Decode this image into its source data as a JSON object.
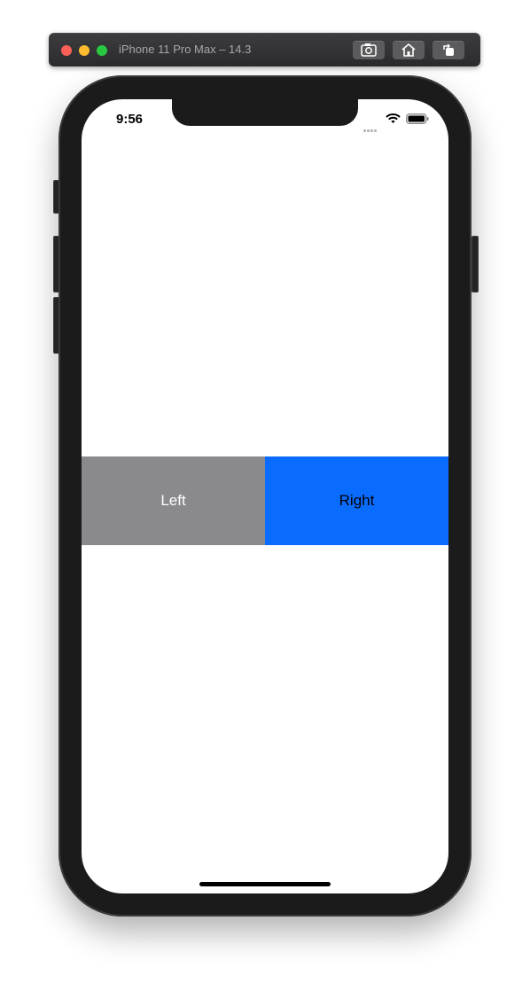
{
  "simulator": {
    "title": "iPhone 11 Pro Max – 14.3",
    "buttons": [
      {
        "icon": "camera-icon",
        "name": "screenshot"
      },
      {
        "icon": "home-icon",
        "name": "home"
      },
      {
        "icon": "rotate-icon",
        "name": "rotate"
      }
    ]
  },
  "status_bar": {
    "time": "9:56",
    "icons": [
      "cellular-dots-icon",
      "wifi-icon",
      "battery-icon"
    ]
  },
  "buttons": {
    "left_label": "Left",
    "right_label": "Right"
  },
  "colors": {
    "left_button_bg": "#8a8a8e",
    "right_button_bg": "#0a6cff",
    "left_button_text": "#ffffff",
    "right_button_text": "#000000"
  }
}
